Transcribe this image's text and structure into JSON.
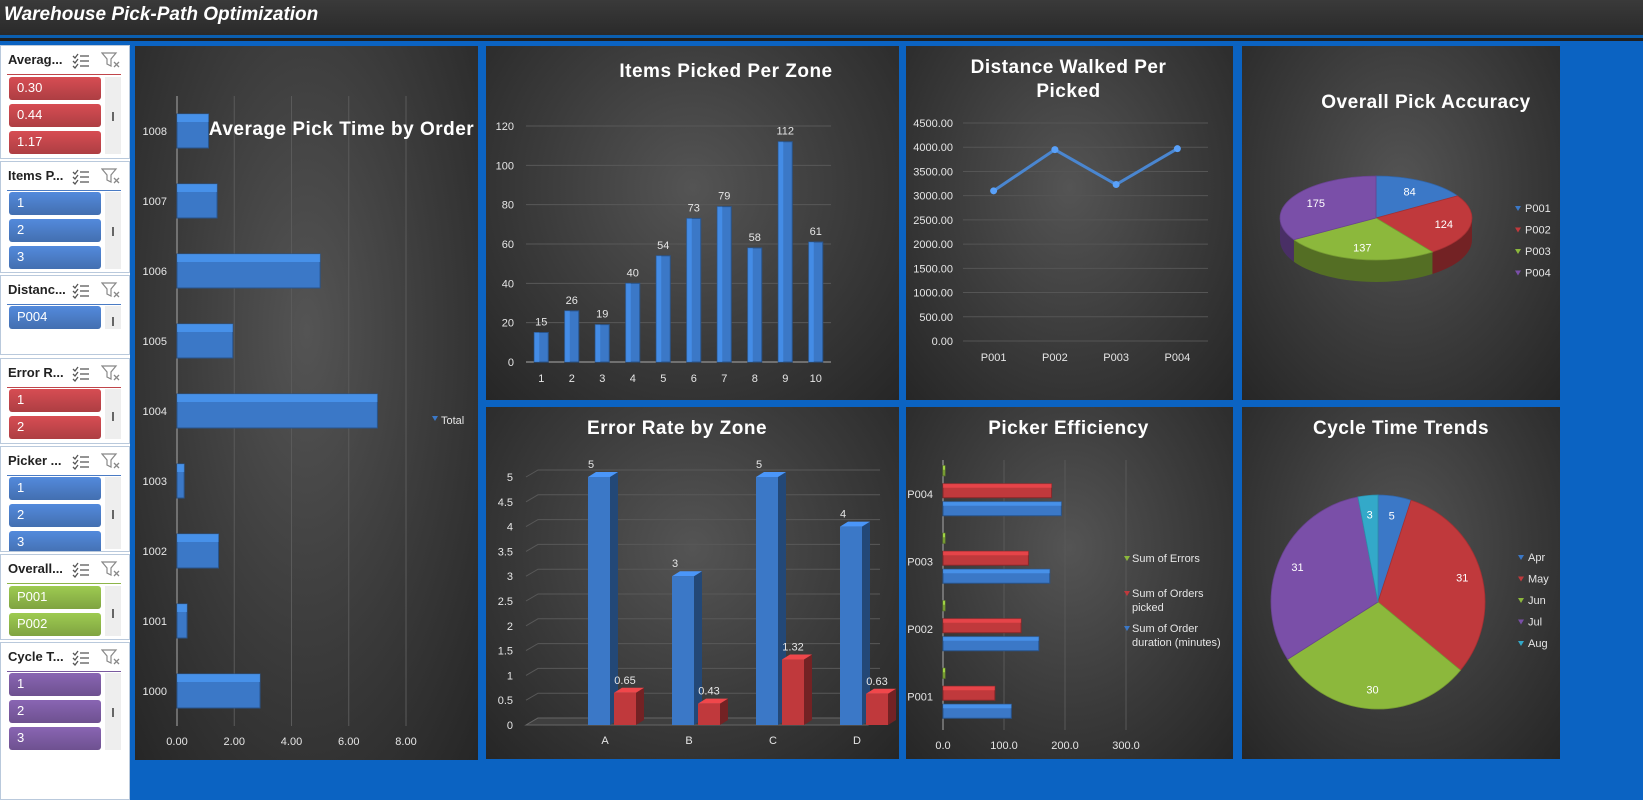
{
  "header": {
    "title": "Warehouse Pick-Path Optimization"
  },
  "slicers": [
    {
      "title": "Averag...",
      "color": "#c0454a",
      "items": [
        "0.30",
        "0.44",
        "1.17"
      ]
    },
    {
      "title": "Items P...",
      "color": "#4a7bc4",
      "items": [
        "1",
        "2",
        "3"
      ]
    },
    {
      "title": "Distanc...",
      "color": "#4a7bc4",
      "items": [
        "P004"
      ]
    },
    {
      "title": "Error R...",
      "color": "#c0454a",
      "items": [
        "1",
        "2"
      ]
    },
    {
      "title": "Picker ...",
      "color": "#4a7bc4",
      "items": [
        "1",
        "2",
        "3"
      ]
    },
    {
      "title": "Overall...",
      "color": "#8db548",
      "items": [
        "P001",
        "P002"
      ]
    },
    {
      "title": "Cycle T...",
      "color": "#7a5aa0",
      "items": [
        "1",
        "2",
        "3"
      ]
    }
  ],
  "chart_data": [
    {
      "type": "bar",
      "orientation": "horizontal",
      "title": "Average Pick Time by Order",
      "categories": [
        "1000",
        "1001",
        "1002",
        "1003",
        "1004",
        "1005",
        "1006",
        "1007",
        "1008"
      ],
      "series": [
        {
          "name": "Total",
          "values": [
            2.9,
            0.35,
            1.45,
            0.25,
            7.0,
            1.95,
            5.0,
            1.4,
            1.1
          ]
        }
      ],
      "xticks": [
        "0.00",
        "2.00",
        "4.00",
        "6.00",
        "8.00"
      ],
      "xlim": [
        0,
        8
      ],
      "legend": "right",
      "color": "#3b78c7"
    },
    {
      "type": "bar",
      "title": "Items Picked Per Zone",
      "categories": [
        "1",
        "2",
        "3",
        "4",
        "5",
        "6",
        "7",
        "8",
        "9",
        "10"
      ],
      "values": [
        15,
        26,
        19,
        40,
        54,
        73,
        79,
        58,
        112,
        61
      ],
      "yticks": [
        "0",
        "20",
        "40",
        "60",
        "80",
        "100",
        "120"
      ],
      "ylim": [
        0,
        120
      ],
      "color": "#3b78c7"
    },
    {
      "type": "line",
      "title": "Distance Walked Per Picked",
      "categories": [
        "P001",
        "P002",
        "P003",
        "P004"
      ],
      "values": [
        3100,
        3950,
        3230,
        3970
      ],
      "yticks": [
        "0.00",
        "500.00",
        "1000.00",
        "1500.00",
        "2000.00",
        "2500.00",
        "3000.00",
        "3500.00",
        "4000.00",
        "4500.00"
      ],
      "ylim": [
        0,
        4500
      ],
      "color": "#4a86d0"
    },
    {
      "type": "pie",
      "title": "Overall Pick Accuracy",
      "categories": [
        "P001",
        "P002",
        "P003",
        "P004"
      ],
      "values": [
        84,
        124,
        137,
        175
      ],
      "colors": [
        "#3b78c7",
        "#c0393c",
        "#8cb83c",
        "#7a4fa8"
      ],
      "legend": "right"
    },
    {
      "type": "bar",
      "title": "Error Rate by Zone",
      "categories": [
        "A",
        "B",
        "C",
        "D"
      ],
      "series": [
        {
          "values": [
            5,
            3,
            5,
            4
          ],
          "color": "#3b78c7",
          "labels": [
            "5",
            "3",
            "5",
            "4"
          ]
        },
        {
          "values": [
            0.65,
            0.43,
            1.32,
            0.63
          ],
          "color": "#c0393c",
          "labels": [
            "0.65",
            "0.43",
            "1.32",
            "0.63"
          ]
        }
      ],
      "yticks": [
        "0",
        "0.5",
        "1",
        "1.5",
        "2",
        "2.5",
        "3",
        "3.5",
        "4",
        "4.5",
        "5"
      ],
      "ylim": [
        0,
        5
      ]
    },
    {
      "type": "bar",
      "orientation": "horizontal",
      "title": "Picker Efficiency",
      "categories": [
        "P001",
        "P002",
        "P003",
        "P004"
      ],
      "series": [
        {
          "name": "Sum of Errors",
          "values": [
            1,
            2,
            2,
            2
          ],
          "color": "#8cb83c"
        },
        {
          "name": "Sum of Orders picked",
          "values": [
            85,
            128,
            140,
            178
          ],
          "color": "#c0393c"
        },
        {
          "name": "Sum of Order duration (minutes)",
          "values": [
            112,
            157,
            175,
            194
          ],
          "color": "#3b78c7"
        }
      ],
      "xticks": [
        "0.0",
        "100.0",
        "200.0",
        "300.0"
      ],
      "xlim": [
        0,
        300
      ],
      "legend": "right"
    },
    {
      "type": "pie",
      "title": "Cycle Time Trends",
      "categories": [
        "Apr",
        "May",
        "Jun",
        "Jul",
        "Aug"
      ],
      "values": [
        5,
        31,
        30,
        31,
        3
      ],
      "colors": [
        "#3b78c7",
        "#c0393c",
        "#8cb83c",
        "#7a4fa8",
        "#33a9c9"
      ],
      "legend": "right"
    }
  ]
}
